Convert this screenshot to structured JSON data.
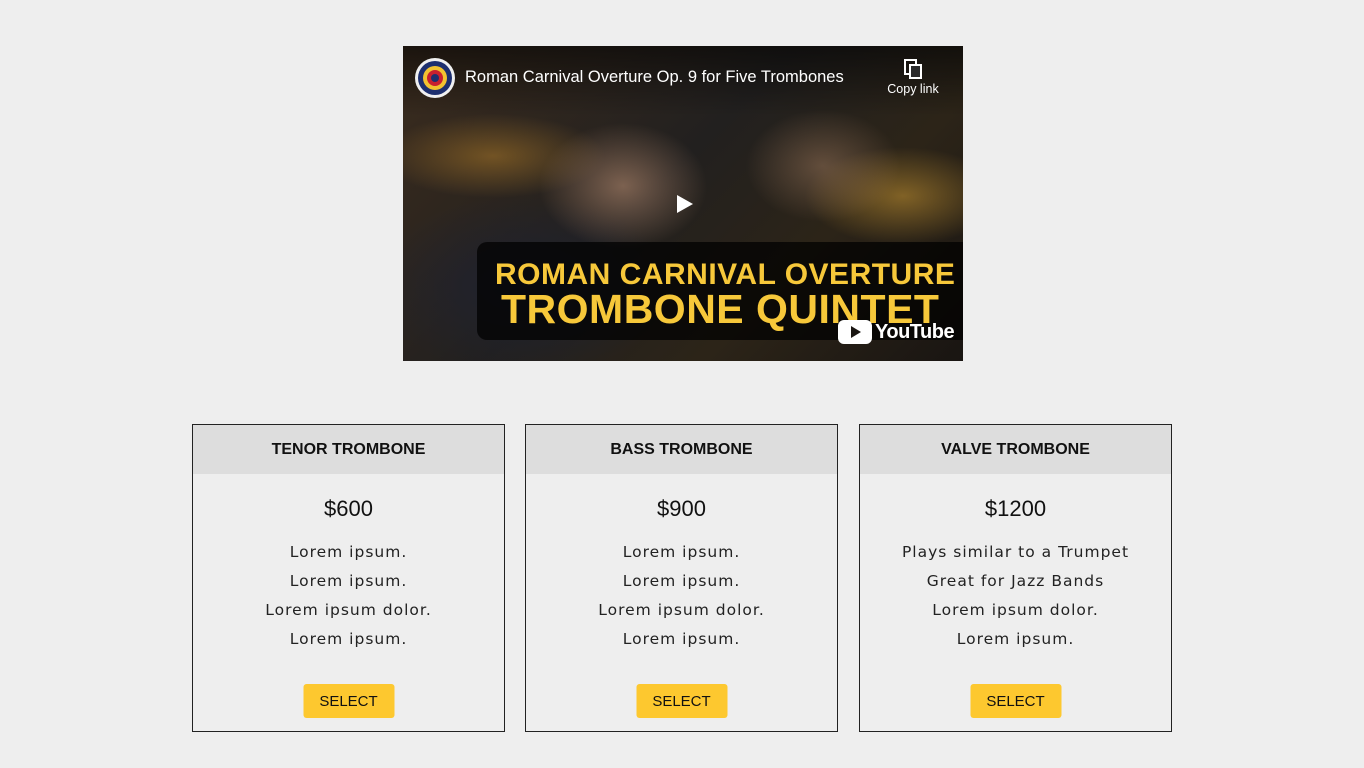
{
  "video": {
    "title": "Roman Carnival Overture Op. 9 for Five Trombones",
    "copy_link_label": "Copy link",
    "banner_line1": "ROMAN CARNIVAL OVERTURE",
    "banner_line2": "TROMBONE QUINTET",
    "youtube_logo_text": "YouTube",
    "play_icon": "play-icon",
    "accent_color": "#f7c83a"
  },
  "cards": [
    {
      "title": "TENOR TROMBONE",
      "price": "$600",
      "features": [
        "Lorem ipsum.",
        "Lorem ipsum.",
        "Lorem ipsum dolor.",
        "Lorem ipsum."
      ],
      "button_label": "SELECT"
    },
    {
      "title": "BASS TROMBONE",
      "price": "$900",
      "features": [
        "Lorem ipsum.",
        "Lorem ipsum.",
        "Lorem ipsum dolor.",
        "Lorem ipsum."
      ],
      "button_label": "SELECT"
    },
    {
      "title": "VALVE TROMBONE",
      "price": "$1200",
      "features": [
        "Plays similar to a Trumpet",
        "Great for Jazz Bands",
        "Lorem ipsum dolor.",
        "Lorem ipsum."
      ],
      "button_label": "SELECT"
    }
  ],
  "colors": {
    "page_background": "#eeeeee",
    "card_header": "#dddddd",
    "button": "#fdc82f"
  }
}
